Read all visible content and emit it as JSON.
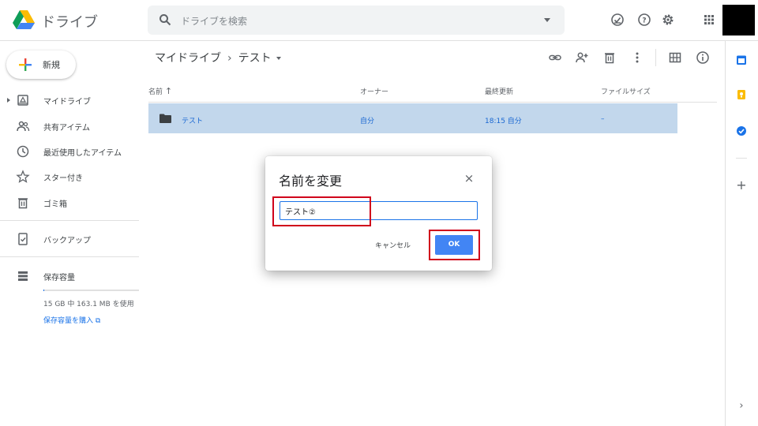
{
  "app": {
    "name": "ドライブ"
  },
  "search": {
    "placeholder": "ドライブを検索"
  },
  "sidebar": {
    "new_label": "新規",
    "items": [
      {
        "label": "マイドライブ",
        "icon": "drive-folder-icon"
      },
      {
        "label": "共有アイテム",
        "icon": "people-icon"
      },
      {
        "label": "最近使用したアイテム",
        "icon": "clock-icon"
      },
      {
        "label": "スター付き",
        "icon": "star-icon"
      },
      {
        "label": "ゴミ箱",
        "icon": "trash-icon"
      },
      {
        "label": "バックアップ",
        "icon": "backup-icon"
      },
      {
        "label": "保存容量",
        "icon": "storage-icon"
      }
    ],
    "storage": {
      "usage_text": "15 GB 中 163.1 MB を使用",
      "buy_link": "保存容量を購入",
      "used_fraction": 0.011
    }
  },
  "main": {
    "breadcrumb": {
      "root": "マイドライブ",
      "separator": "›",
      "current": "テスト"
    },
    "columns": {
      "name": "名前",
      "sort_arrow": "↑",
      "owner": "オーナー",
      "modified": "最終更新",
      "size": "ファイルサイズ"
    },
    "rows": [
      {
        "name": "テスト",
        "owner": "自分",
        "modified": "18:15 自分",
        "size": "–"
      }
    ]
  },
  "dialog": {
    "title": "名前を変更",
    "close": "×",
    "input_value": "テスト②",
    "cancel_label": "キャンセル",
    "ok_label": "OK"
  },
  "colors": {
    "accent": "#4285f4",
    "highlight": "#d0021b",
    "selected_row": "#c2d7ec"
  }
}
